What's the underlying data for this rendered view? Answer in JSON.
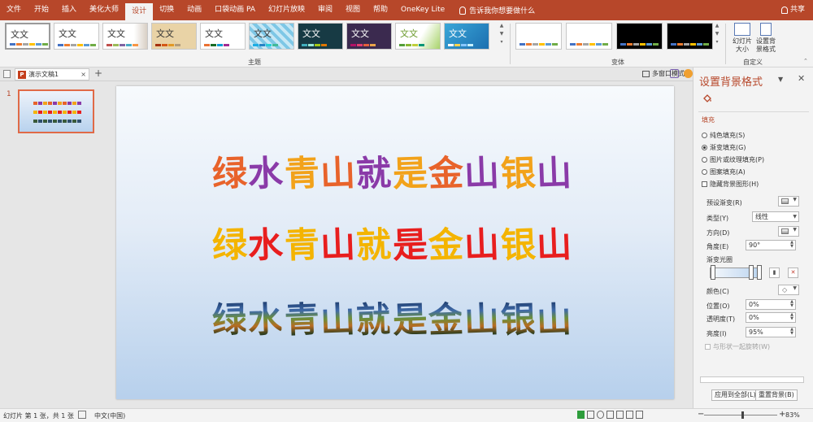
{
  "colors": {
    "brand": "#b7472a",
    "line1": [
      "#e8632b",
      "#8a3aa8",
      "#f2a21a",
      "#e8632b",
      "#8a3aa8",
      "#f2a21a",
      "#e8632b",
      "#8a3aa8",
      "#f2a21a"
    ],
    "line2": [
      "#f4b400",
      "#e81e1e",
      "#f4b400",
      "#e81e1e",
      "#f4b400",
      "#e81e1e",
      "#f4b400",
      "#e81e1e",
      "#f4b400"
    ]
  },
  "ribbon_tabs": [
    "文件",
    "开始",
    "插入",
    "美化大师",
    "设计",
    "切换",
    "动画",
    "口袋动画 PA",
    "幻灯片放映",
    "审阅",
    "视图",
    "帮助",
    "OneKey Lite"
  ],
  "active_tab_index": 4,
  "tell_me": "告诉我你想要做什么",
  "share_label": "共享",
  "themes": {
    "items": [
      "文文",
      "文文",
      "文文",
      "文文",
      "文文",
      "文文",
      "文文",
      "文文",
      "文文",
      "文文"
    ],
    "group_label": "主题"
  },
  "variants": {
    "group_label": "变体"
  },
  "customize": {
    "slide_size": "幻灯片大小",
    "format_bg": "设置背景格式",
    "group_label": "自定义"
  },
  "document": {
    "tab_name": "演示文稿1",
    "close_glyph": "×",
    "add_glyph": "+",
    "multi_window": "多窗口模式"
  },
  "thumbnails": {
    "slide_number": "1"
  },
  "slide": {
    "line1": [
      "绿",
      "水",
      "青",
      "山",
      "就",
      "是",
      "金",
      "山",
      "银",
      "山"
    ],
    "line2": [
      "绿",
      "水",
      "青",
      "山",
      "就",
      "是",
      "金",
      "山",
      "银",
      "山"
    ],
    "line3": [
      "绿",
      "水",
      "青",
      "山",
      "就",
      "是",
      "金",
      "山",
      "银",
      "山"
    ]
  },
  "format_pane": {
    "title": "设置背景格式",
    "section": "填充",
    "fill_options": [
      "纯色填充(S)",
      "渐变填充(G)",
      "图片或纹理填充(P)",
      "图案填充(A)"
    ],
    "selected_fill_index": 1,
    "hide_bg": "隐藏背景图形(H)",
    "preset_label": "预设渐变(R)",
    "type_label": "类型(Y)",
    "type_value": "线性",
    "direction_label": "方向(D)",
    "angle_label": "角度(E)",
    "angle_value": "90°",
    "stops_label": "渐变光圈",
    "color_label": "颜色(C)",
    "position_label": "位置(O)",
    "position_value": "0%",
    "transparency_label": "透明度(T)",
    "transparency_value": "0%",
    "brightness_label": "亮度(I)",
    "brightness_value": "95%",
    "rotate_with_shape": "与形状一起旋转(W)",
    "apply_all": "应用到全部(L)",
    "reset_bg": "重置背景(B)"
  },
  "status": {
    "slide_info": "幻灯片 第 1 张，共 1 张",
    "language": "中文(中国)",
    "zoom": "83%"
  }
}
